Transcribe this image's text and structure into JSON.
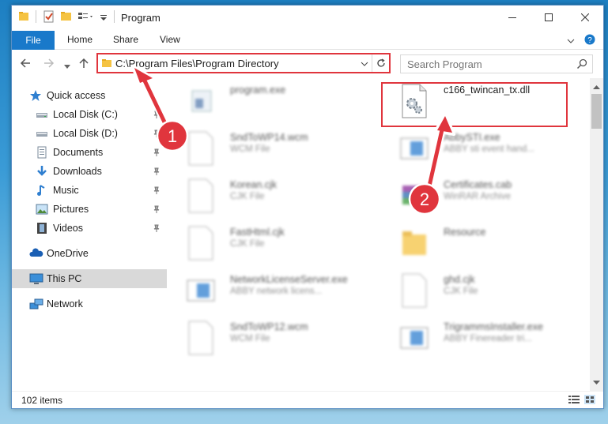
{
  "window": {
    "title": "Program"
  },
  "ribbon": {
    "tabs": [
      "File",
      "Home",
      "Share",
      "View"
    ]
  },
  "address": {
    "path": "C:\\Program Files\\Program Directory"
  },
  "search": {
    "placeholder": "Search Program"
  },
  "sidebar": {
    "items": [
      {
        "label": "Quick access",
        "icon": "star-icon",
        "pinned": false
      },
      {
        "label": "Local Disk (C:)",
        "icon": "drive-icon",
        "pinned": true
      },
      {
        "label": "Local Disk (D:)",
        "icon": "drive-icon",
        "pinned": true
      },
      {
        "label": "Documents",
        "icon": "documents-icon",
        "pinned": true
      },
      {
        "label": "Downloads",
        "icon": "downloads-icon",
        "pinned": true
      },
      {
        "label": "Music",
        "icon": "music-icon",
        "pinned": true
      },
      {
        "label": "Pictures",
        "icon": "pictures-icon",
        "pinned": true
      },
      {
        "label": "Videos",
        "icon": "videos-icon",
        "pinned": true
      },
      {
        "label": "OneDrive",
        "icon": "cloud-icon",
        "pinned": false
      },
      {
        "label": "This PC",
        "icon": "computer-icon",
        "pinned": false,
        "selected": true
      },
      {
        "label": "Network",
        "icon": "network-icon",
        "pinned": false
      }
    ]
  },
  "files": [
    {
      "name": "program.exe",
      "type": "",
      "icon": "exe-icon"
    },
    {
      "name": "c166_twincan_tx.dll",
      "type": "",
      "icon": "dll-gear-icon"
    },
    {
      "name": "SndToWP14.wcm",
      "type": "WCM File",
      "icon": "blank-file-icon"
    },
    {
      "name": "AbbySTI.exe",
      "type": "ABBY sti event hand...",
      "icon": "app-window-icon"
    },
    {
      "name": "Korean.cjk",
      "type": "CJK File",
      "icon": "blank-file-icon"
    },
    {
      "name": "Certificates.cab",
      "type": "WinRAR Archive",
      "icon": "winrar-icon"
    },
    {
      "name": "FastHtml.cjk",
      "type": "CJK File",
      "icon": "blank-file-icon"
    },
    {
      "name": "Resource",
      "type": "",
      "icon": "folder-icon"
    },
    {
      "name": "NetworkLicenseServer.exe",
      "type": "ABBY network licens...",
      "icon": "app-window-icon"
    },
    {
      "name": "ghd.cjk",
      "type": "CJK File",
      "icon": "blank-file-icon"
    },
    {
      "name": "SndToWP12.wcm",
      "type": "WCM File",
      "icon": "blank-file-icon"
    },
    {
      "name": "TrigrammsInstaller.exe",
      "type": "ABBY Finereader tri...",
      "icon": "app-window-icon"
    }
  ],
  "status": {
    "count": "102 items"
  },
  "annotations": {
    "badge1": "1",
    "badge2": "2",
    "color": "#e0353d"
  }
}
